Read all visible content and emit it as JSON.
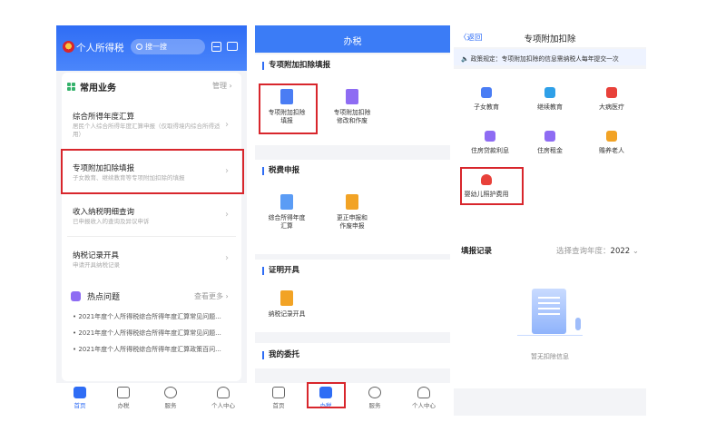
{
  "home": {
    "app_title": "个人所得税",
    "search_placeholder": "搜一搜",
    "section_title": "常用业务",
    "manage_label": "管理",
    "items": [
      {
        "title": "综合所得年度汇算",
        "subtitle": "居民个人综合所得年度汇算申报（仅取得境内综合所得适用）"
      },
      {
        "title": "专项附加扣除填报",
        "subtitle": "子女教育、继续教育等专项附加扣除的填报"
      },
      {
        "title": "收入纳税明细查询",
        "subtitle": "已申报收入的查询及异议申诉"
      },
      {
        "title": "纳税记录开具",
        "subtitle": "申请开具纳税记录"
      }
    ],
    "hot": {
      "title": "热点问题",
      "more": "查看更多",
      "lines": [
        "• 2021年度个人所得税综合所得年度汇算常见问题...",
        "• 2021年度个人所得税综合所得年度汇算常见问题...",
        "• 2021年度个人所得税综合所得年度汇算政策百问..."
      ]
    }
  },
  "tabbar": {
    "tabs": [
      "首页",
      "办税",
      "服务",
      "个人中心"
    ]
  },
  "office": {
    "title": "办税",
    "sections": [
      {
        "title": "专项附加扣除填报",
        "items": [
          "专项附加扣除\n填报",
          "专项附加扣除\n修改和作废"
        ]
      },
      {
        "title": "税费申报",
        "items": [
          "综合所得年度\n汇算",
          "更正申报和\n作废申报"
        ]
      },
      {
        "title": "证明开具",
        "items": [
          "纳税记录开具"
        ]
      },
      {
        "title": "我的委托",
        "items": []
      }
    ]
  },
  "deduction": {
    "back_label": "〈返回",
    "title": "专项附加扣除",
    "policy": "政策规定：专项附加扣除的信息需纳税人每年提交一次",
    "categories": [
      "子女教育",
      "继续教育",
      "大病医疗",
      "住房贷款利息",
      "住房租金",
      "赡养老人",
      "婴幼儿照护费用"
    ],
    "records_title": "填报记录",
    "year_label": "选择查询年度：",
    "year_value": "2022",
    "empty_text": "暂无扣除信息"
  },
  "colors": {
    "primary": "#2f6df5",
    "highlight_box": "#d8262c",
    "category_icons": [
      "#4a7df4",
      "#2fa0e8",
      "#e8413a",
      "#8e6cf3",
      "#8e6cf3",
      "#f2a325",
      "#e8413a"
    ]
  }
}
